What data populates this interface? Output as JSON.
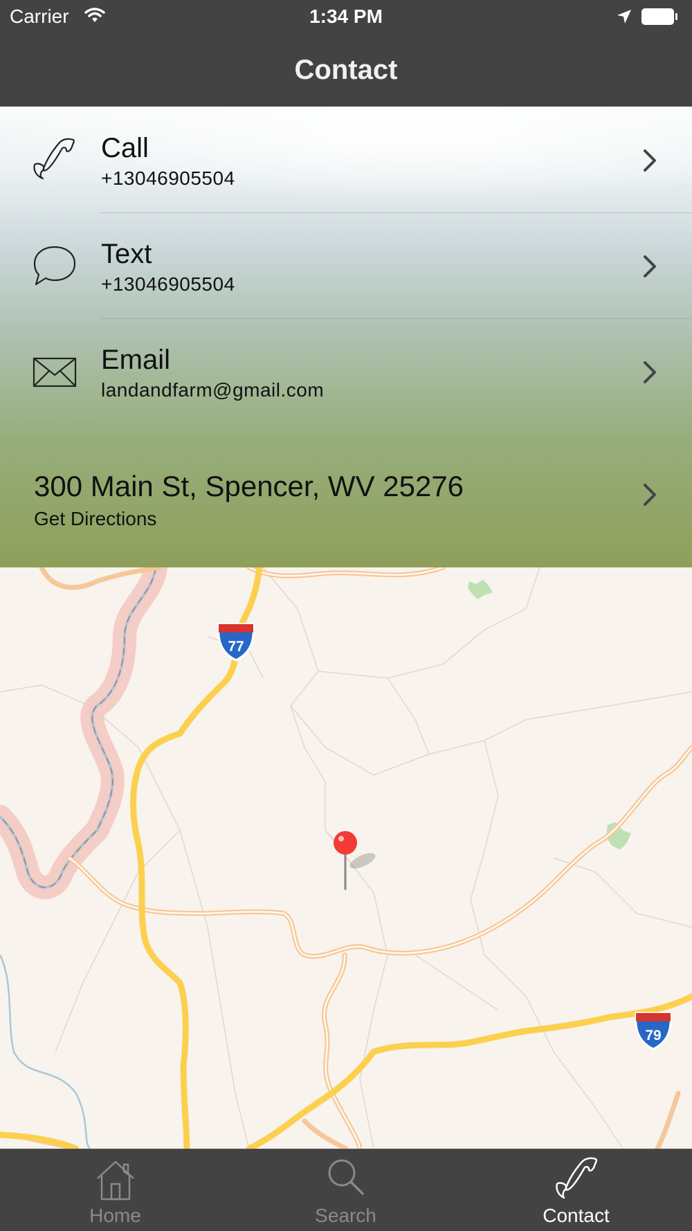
{
  "status_bar": {
    "carrier": "Carrier",
    "time": "1:34 PM",
    "icons": [
      "wifi-icon",
      "location-arrow-icon",
      "battery-icon"
    ]
  },
  "nav": {
    "title": "Contact"
  },
  "contact": {
    "call": {
      "title": "Call",
      "value": "+13046905504",
      "icon": "phone-icon"
    },
    "text": {
      "title": "Text",
      "value": "+13046905504",
      "icon": "speech-bubble-icon"
    },
    "email": {
      "title": "Email",
      "value": "landandfarm@gmail.com",
      "icon": "envelope-icon"
    },
    "address": {
      "line": "300 Main St, Spencer, WV 25276",
      "action": "Get Directions"
    }
  },
  "map": {
    "shields": [
      "77",
      "79"
    ],
    "pin_color": "#f23b34"
  },
  "tab_bar": {
    "tabs": [
      {
        "label": "Home",
        "icon": "house-icon",
        "active": false
      },
      {
        "label": "Search",
        "icon": "magnifier-icon",
        "active": false
      },
      {
        "label": "Contact",
        "icon": "phone-icon",
        "active": true
      }
    ]
  },
  "colors": {
    "bar_background": "#434343",
    "active_tab": "#ffffff",
    "inactive_tab": "#8a8a8a",
    "road_major": "#fcd04f",
    "road_minor": "#f6c79a"
  }
}
